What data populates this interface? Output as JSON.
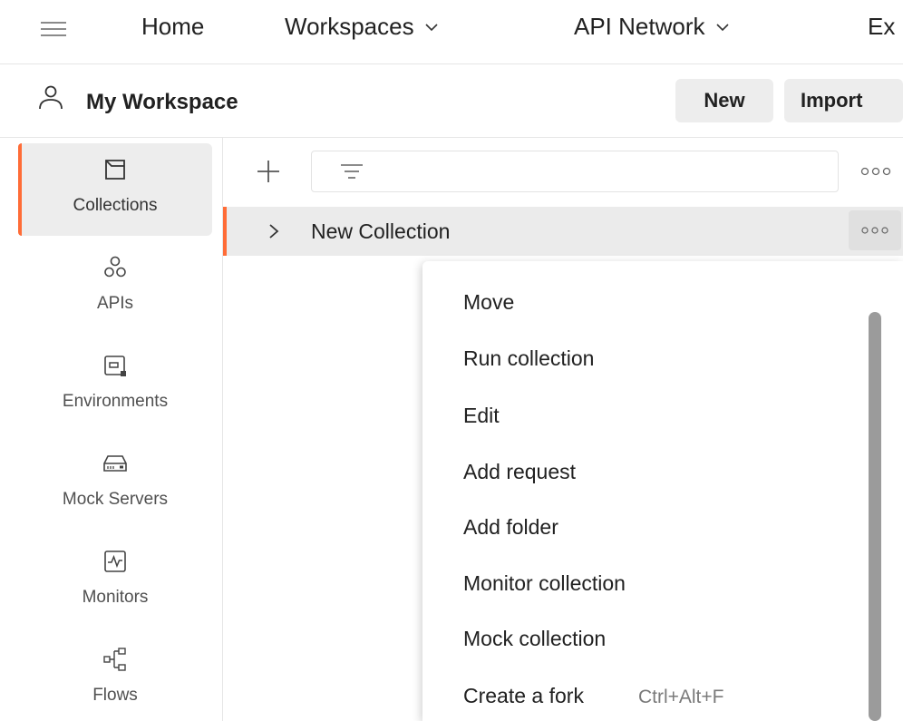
{
  "topnav": {
    "home": "Home",
    "workspaces": "Workspaces",
    "api_network": "API Network",
    "explore": "Ex"
  },
  "workspace": {
    "title": "My Workspace",
    "new_label": "New",
    "import_label": "Import"
  },
  "sidebar": {
    "items": [
      {
        "label": "Collections",
        "icon": "collections-icon",
        "active": true
      },
      {
        "label": "APIs",
        "icon": "apis-icon",
        "active": false
      },
      {
        "label": "Environments",
        "icon": "environments-icon",
        "active": false
      },
      {
        "label": "Mock Servers",
        "icon": "mock-servers-icon",
        "active": false
      },
      {
        "label": "Monitors",
        "icon": "monitors-icon",
        "active": false
      },
      {
        "label": "Flows",
        "icon": "flows-icon",
        "active": false
      }
    ]
  },
  "collections": {
    "rows": [
      {
        "label": "New Collection"
      }
    ]
  },
  "menu": {
    "items": [
      {
        "label": "Move",
        "shortcut": ""
      },
      {
        "label": "Run collection",
        "shortcut": ""
      },
      {
        "label": "Edit",
        "shortcut": ""
      },
      {
        "label": "Add request",
        "shortcut": ""
      },
      {
        "label": "Add folder",
        "shortcut": ""
      },
      {
        "label": "Monitor collection",
        "shortcut": ""
      },
      {
        "label": "Mock collection",
        "shortcut": ""
      },
      {
        "label": "Create a fork",
        "shortcut": "Ctrl+Alt+F"
      }
    ]
  },
  "colors": {
    "accent": "#ff6c37",
    "button_bg": "#ededed",
    "row_selected": "#ebebeb",
    "text": "#212121"
  }
}
